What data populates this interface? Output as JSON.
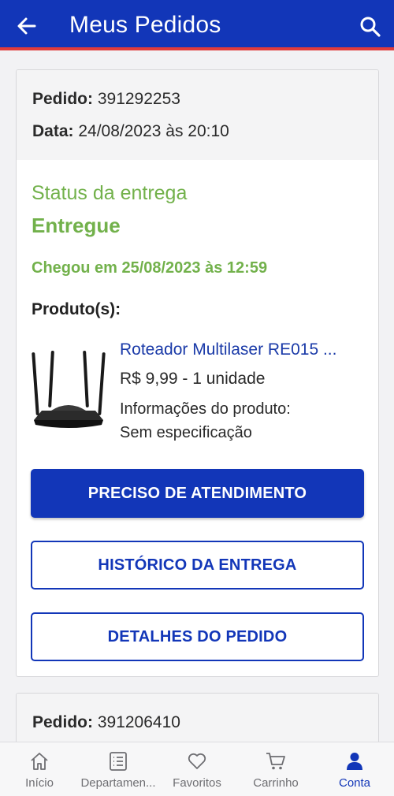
{
  "header": {
    "title": "Meus Pedidos",
    "back_icon": "arrow-left-icon",
    "search_icon": "search-icon",
    "bg_color": "#1236b8",
    "accent_line_color": "#e03b3b"
  },
  "orders": [
    {
      "order_label": "Pedido:",
      "order_number": "391292253",
      "date_label": "Data:",
      "date_value": "24/08/2023 às 20:10",
      "status_label": "Status da entrega",
      "status_value": "Entregue",
      "status_color": "#72b14b",
      "arrival_text": "Chegou em 25/08/2023 às 12:59",
      "products_title": "Produto(s):",
      "product": {
        "image_icon": "router-image",
        "name": "Roteador Multilaser RE015 ...",
        "price_qty": "R$ 9,99 - 1 unidade",
        "info_label": "Informações do produto:",
        "info_value": "Sem especificação"
      },
      "buttons": {
        "support": "PRECISO DE ATENDIMENTO",
        "history": "HISTÓRICO DA ENTREGA",
        "details": "DETALHES DO PEDIDO"
      }
    },
    {
      "order_label": "Pedido:",
      "order_number": "391206410"
    }
  ],
  "bottom_nav": [
    {
      "label": "Início",
      "icon": "home-icon",
      "active": false
    },
    {
      "label": "Departamen...",
      "icon": "list-icon",
      "active": false
    },
    {
      "label": "Favoritos",
      "icon": "heart-icon",
      "active": false
    },
    {
      "label": "Carrinho",
      "icon": "cart-icon",
      "active": false
    },
    {
      "label": "Conta",
      "icon": "user-icon",
      "active": true
    }
  ]
}
